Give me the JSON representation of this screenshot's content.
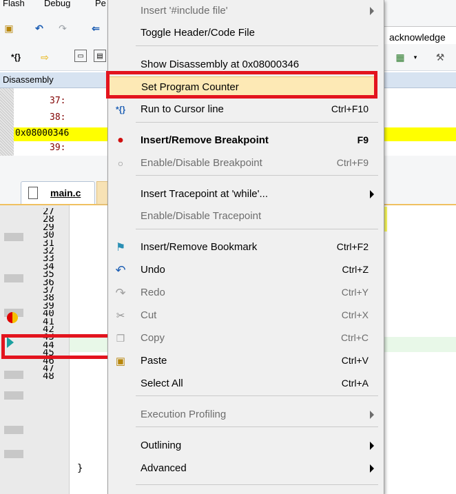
{
  "menubar": {
    "items": [
      "Flash",
      "Debug",
      "Pe"
    ]
  },
  "toolbar": {
    "field_text": "acknowledge"
  },
  "disassembly": {
    "title": "Disassembly",
    "lines": [
      {
        "text": "37:"
      },
      {
        "text": "38:"
      },
      {
        "text": "0x08000346"
      },
      {
        "text": "39:"
      }
    ]
  },
  "editor": {
    "tab_label": "main.c",
    "line_numbers": [
      "27",
      "28",
      "29",
      "30",
      "31",
      "32",
      "33",
      "34",
      "35",
      "36",
      "37",
      "38",
      "39",
      "40",
      "41",
      "42",
      "43",
      "44",
      "45",
      "46",
      "47",
      "48"
    ],
    "current_line": "37",
    "close_brace": "}"
  },
  "context_menu": {
    "items": [
      {
        "label": "Insert '#include file'",
        "shortcut": "",
        "submenu": true,
        "disabled": true,
        "icon": ""
      },
      {
        "label": "Toggle Header/Code File",
        "shortcut": "",
        "submenu": false,
        "disabled": false,
        "icon": ""
      },
      {
        "label": "Show Disassembly at 0x08000346",
        "shortcut": "",
        "submenu": false,
        "disabled": false,
        "icon": ""
      },
      {
        "label": "Set Program Counter",
        "shortcut": "",
        "submenu": false,
        "disabled": false,
        "icon": "",
        "highlighted": true
      },
      {
        "label": "Run to Cursor line",
        "shortcut": "Ctrl+F10",
        "submenu": false,
        "disabled": false,
        "icon": "run-to-cursor-icon",
        "glyph": "*{}"
      },
      {
        "label": "Insert/Remove Breakpoint",
        "shortcut": "F9",
        "submenu": false,
        "disabled": false,
        "bold": true,
        "icon": "breakpoint-icon"
      },
      {
        "label": "Enable/Disable Breakpoint",
        "shortcut": "Ctrl+F9",
        "submenu": false,
        "disabled": true,
        "icon": "breakpoint-disabled-icon"
      },
      {
        "label": "Insert Tracepoint at 'while'...",
        "shortcut": "",
        "submenu": true,
        "disabled": false,
        "icon": ""
      },
      {
        "label": "Enable/Disable Tracepoint",
        "shortcut": "",
        "submenu": false,
        "disabled": true,
        "icon": ""
      },
      {
        "label": "Insert/Remove Bookmark",
        "shortcut": "Ctrl+F2",
        "submenu": false,
        "disabled": false,
        "icon": "bookmark-flag-icon"
      },
      {
        "label": "Undo",
        "shortcut": "Ctrl+Z",
        "submenu": false,
        "disabled": false,
        "icon": "undo-icon"
      },
      {
        "label": "Redo",
        "shortcut": "Ctrl+Y",
        "submenu": false,
        "disabled": true,
        "icon": "redo-icon"
      },
      {
        "label": "Cut",
        "shortcut": "Ctrl+X",
        "submenu": false,
        "disabled": true,
        "icon": "scissors-icon"
      },
      {
        "label": "Copy",
        "shortcut": "Ctrl+C",
        "submenu": false,
        "disabled": true,
        "icon": "copy-icon"
      },
      {
        "label": "Paste",
        "shortcut": "Ctrl+V",
        "submenu": false,
        "disabled": false,
        "icon": "paste-icon"
      },
      {
        "label": "Select All",
        "shortcut": "Ctrl+A",
        "submenu": false,
        "disabled": false,
        "icon": ""
      },
      {
        "label": "Execution Profiling",
        "shortcut": "",
        "submenu": true,
        "disabled": true,
        "icon": ""
      },
      {
        "label": "Outlining",
        "shortcut": "",
        "submenu": true,
        "disabled": false,
        "icon": ""
      },
      {
        "label": "Advanced",
        "shortcut": "",
        "submenu": true,
        "disabled": false,
        "icon": ""
      }
    ]
  },
  "colors": {
    "highlight": "#fde9b5",
    "annotation_red": "#e3141e",
    "pc_line_yellow": "#ffff00"
  }
}
